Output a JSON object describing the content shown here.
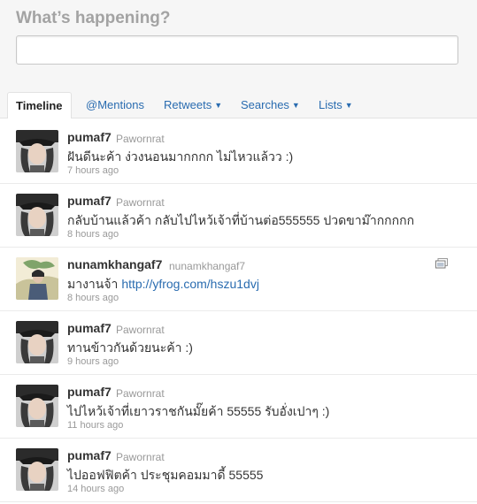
{
  "header": {
    "title": "What’s happening?",
    "composer_value": ""
  },
  "tabs": [
    {
      "label": "Timeline",
      "caret": false,
      "active": true
    },
    {
      "label": "@Mentions",
      "caret": false
    },
    {
      "label": "Retweets",
      "caret": true
    },
    {
      "label": "Searches",
      "caret": true
    },
    {
      "label": "Lists",
      "caret": true
    }
  ],
  "caret_glyph": "▼",
  "tweets": [
    {
      "username": "pumaf7",
      "realname": "Pawornrat",
      "text": "ฝันดีนะค้า ง่วงนอนมากกกก ไม่ไหวแล้วว :)",
      "time": "7 hours ago",
      "avatar": "girl-cap"
    },
    {
      "username": "pumaf7",
      "realname": "Pawornrat",
      "text": "กลับบ้านแล้วค้า กลับไปไหว้เจ้าที่บ้านต่อ555555 ปวดขาม๊ากกกกก",
      "time": "8 hours ago",
      "avatar": "girl-cap"
    },
    {
      "username": "nunamkhangaf7",
      "realname": "nunamkhangaf7",
      "text": "มางานจ้า ",
      "link": "http://yfrog.com/hszu1dvj",
      "time": "8 hours ago",
      "avatar": "girl-tree",
      "media": "image-icon"
    },
    {
      "username": "pumaf7",
      "realname": "Pawornrat",
      "text": "ทานข้าวกันด้วยนะค้า :)",
      "time": "9 hours ago",
      "avatar": "girl-cap"
    },
    {
      "username": "pumaf7",
      "realname": "Pawornrat",
      "text": "ไปไหว้เจ้าที่เยาวราชกันมั๊ยค้า 55555 รับอั่งเปาๆ :)",
      "time": "11 hours ago",
      "avatar": "girl-cap"
    },
    {
      "username": "pumaf7",
      "realname": "Pawornrat",
      "text": "ไปออฟฟิตค้า ประชุมคอมมาดี้ 55555",
      "time": "14 hours ago",
      "avatar": "girl-cap"
    }
  ],
  "colors": {
    "link": "#2a6cb0",
    "title": "#a3a3a3",
    "meta": "#999999"
  }
}
